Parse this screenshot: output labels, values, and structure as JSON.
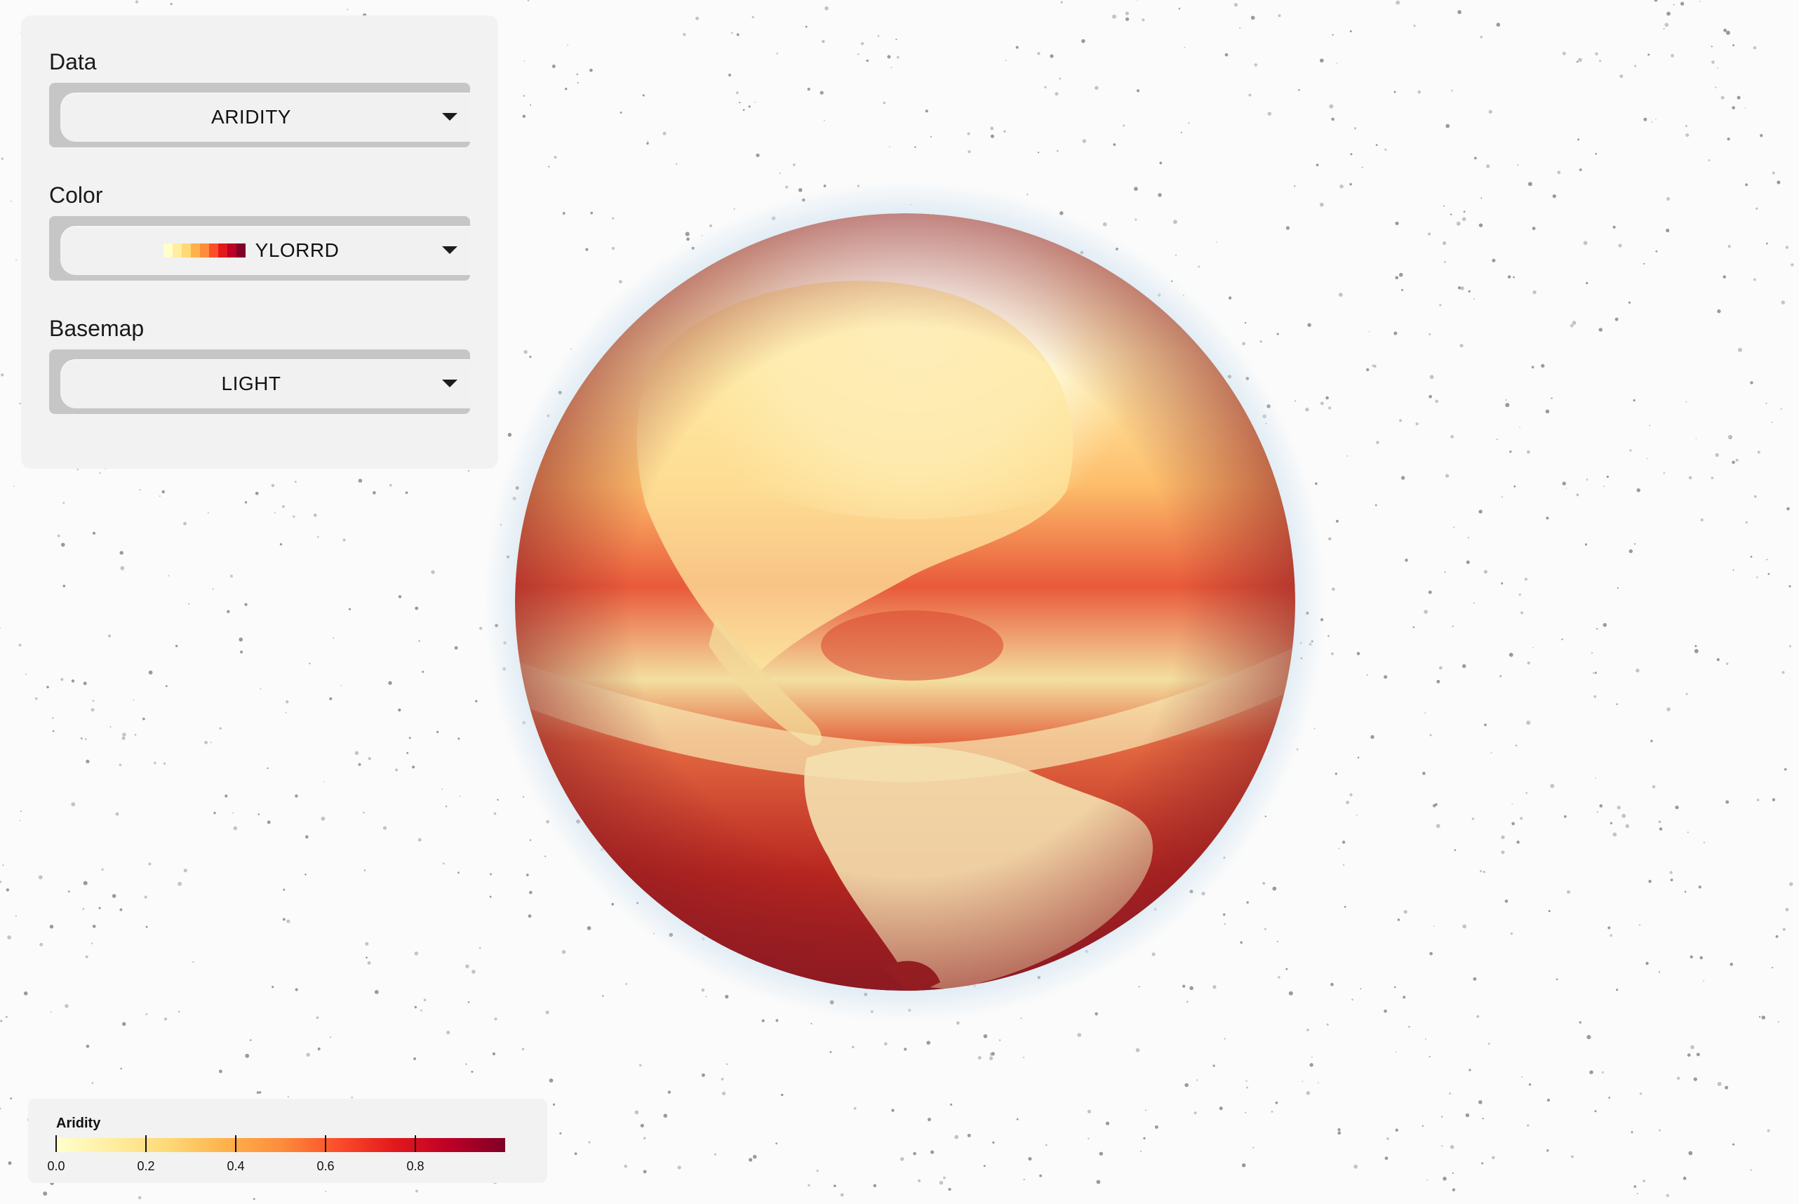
{
  "controls": {
    "data": {
      "label": "Data",
      "value": "ARIDITY"
    },
    "color": {
      "label": "Color",
      "value": "YLORRD"
    },
    "basemap": {
      "label": "Basemap",
      "value": "LIGHT"
    }
  },
  "palette": [
    "#ffffcc",
    "#ffeda0",
    "#fed976",
    "#feb24c",
    "#fd8d3c",
    "#fc4e2a",
    "#e31a1c",
    "#bd0026",
    "#800026"
  ],
  "icons": {
    "dropdown": "caret-down-icon"
  },
  "legend": {
    "title": "Aridity",
    "ticks": [
      "0.0",
      "0.2",
      "0.4",
      "0.6",
      "0.8"
    ],
    "domain": [
      0,
      1
    ],
    "tick_values": [
      0,
      0.2,
      0.4,
      0.6,
      0.8
    ]
  },
  "colors": {
    "panel_bg": "#f2f2f2",
    "select_border": "#c6c6c6",
    "background": "#fbfbfb"
  }
}
